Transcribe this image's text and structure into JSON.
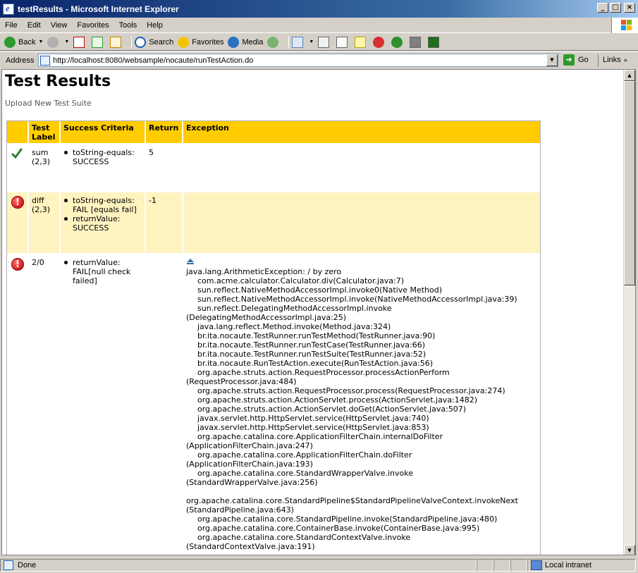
{
  "window": {
    "title": "testResults - Microsoft Internet Explorer",
    "controls": [
      "_",
      "□",
      "×"
    ]
  },
  "menu": [
    "File",
    "Edit",
    "View",
    "Favorites",
    "Tools",
    "Help"
  ],
  "toolbar": {
    "back": "Back",
    "search": "Search",
    "favorites": "Favorites",
    "media": "Media"
  },
  "address": {
    "label": "Address",
    "url": "http://localhost:8080/websample/nocaute/runTestAction.do",
    "go": "Go",
    "links": "Links"
  },
  "page": {
    "title": "Test Results",
    "upload_link": "Upload New Test Suite",
    "columns": [
      "",
      "Test Label",
      "Success Criteria",
      "Return",
      "Exception"
    ],
    "rows": [
      {
        "status": "success",
        "label": "sum (2,3)",
        "criteria": [
          "toString-equals: SUCCESS"
        ],
        "return": "5",
        "exception": ""
      },
      {
        "status": "fail",
        "label": "diff (2,3)",
        "criteria": [
          "toString-equals: FAIL [equals fail]",
          "returnValue: SUCCESS"
        ],
        "return": "-1",
        "exception": ""
      },
      {
        "status": "fail",
        "label": "2/0",
        "criteria": [
          "returnValue: FAIL[null check failed]"
        ],
        "return": "",
        "exception": {
          "head": "java.lang.ArithmeticException: / by zero",
          "lines": [
            {
              "t": "com.acme.calculator.Calculator.div(Calculator.java:7)",
              "indent": true
            },
            {
              "t": "sun.reflect.NativeMethodAccessorImpl.invoke0(Native Method)",
              "indent": true
            },
            {
              "t": "sun.reflect.NativeMethodAccessorImpl.invoke(NativeMethodAccessorImpl.java:39)",
              "indent": true
            },
            {
              "t": "sun.reflect.DelegatingMethodAccessorImpl.invoke",
              "indent": true
            },
            {
              "t": "(DelegatingMethodAccessorImpl.java:25)",
              "indent": false
            },
            {
              "t": "java.lang.reflect.Method.invoke(Method.java:324)",
              "indent": true
            },
            {
              "t": "br.ita.nocaute.TestRunner.runTestMethod(TestRunner.java:90)",
              "indent": true
            },
            {
              "t": "br.ita.nocaute.TestRunner.runTestCase(TestRunner.java:66)",
              "indent": true
            },
            {
              "t": "br.ita.nocaute.TestRunner.runTestSuite(TestRunner.java:52)",
              "indent": true
            },
            {
              "t": "br.ita.nocaute.RunTestAction.execute(RunTestAction.java:56)",
              "indent": true
            },
            {
              "t": "org.apache.struts.action.RequestProcessor.processActionPerform",
              "indent": true
            },
            {
              "t": "(RequestProcessor.java:484)",
              "indent": false
            },
            {
              "t": "org.apache.struts.action.RequestProcessor.process(RequestProcessor.java:274)",
              "indent": true
            },
            {
              "t": "org.apache.struts.action.ActionServlet.process(ActionServlet.java:1482)",
              "indent": true
            },
            {
              "t": "org.apache.struts.action.ActionServlet.doGet(ActionServlet.java:507)",
              "indent": true
            },
            {
              "t": "javax.servlet.http.HttpServlet.service(HttpServlet.java:740)",
              "indent": true
            },
            {
              "t": "javax.servlet.http.HttpServlet.service(HttpServlet.java:853)",
              "indent": true
            },
            {
              "t": "org.apache.catalina.core.ApplicationFilterChain.internalDoFilter",
              "indent": true
            },
            {
              "t": "(ApplicationFilterChain.java:247)",
              "indent": false
            },
            {
              "t": "org.apache.catalina.core.ApplicationFilterChain.doFilter",
              "indent": true
            },
            {
              "t": "(ApplicationFilterChain.java:193)",
              "indent": false
            },
            {
              "t": "org.apache.catalina.core.StandardWrapperValve.invoke",
              "indent": true
            },
            {
              "t": "(StandardWrapperValve.java:256)",
              "indent": false
            },
            {
              "t": "",
              "indent": false
            },
            {
              "t": "org.apache.catalina.core.StandardPipeline$StandardPipelineValveContext.invokeNext",
              "indent": false
            },
            {
              "t": "(StandardPipeline.java:643)",
              "indent": false
            },
            {
              "t": "org.apache.catalina.core.StandardPipeline.invoke(StandardPipeline.java:480)",
              "indent": true
            },
            {
              "t": "org.apache.catalina.core.ContainerBase.invoke(ContainerBase.java:995)",
              "indent": true
            },
            {
              "t": "org.apache.catalina.core.StandardContextValve.invoke",
              "indent": true
            },
            {
              "t": "(StandardContextValve.java:191)",
              "indent": false
            }
          ]
        }
      }
    ]
  },
  "status": {
    "text": "Done",
    "zone": "Local intranet"
  },
  "colors": {
    "header_bg": "#ffcc00",
    "fail_row_bg": "#fff3c0",
    "success": "#2e7d32",
    "fail": "#c00000"
  }
}
